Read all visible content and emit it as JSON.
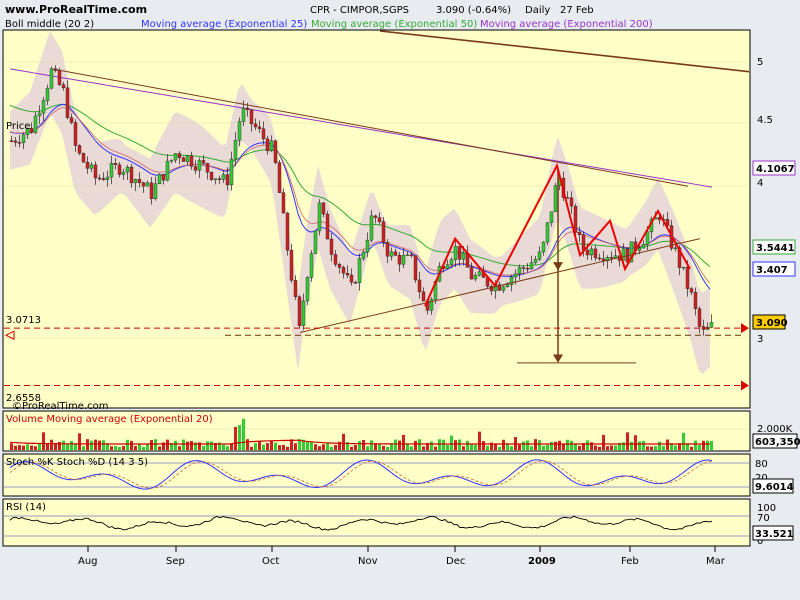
{
  "header": {
    "website": "www.ProRealTime.com",
    "instrument": "CPR - CIMPOR,SGPS",
    "quote": "3.090 (-0.64%)",
    "period": "Daily",
    "date": "27 Feb"
  },
  "colors": {
    "background": "#ffffc8",
    "boll_band": "#e8d6d6",
    "ma25": "#3333ff",
    "ma50": "#33aa33",
    "ma200": "#9933cc",
    "trend": "#7a3a1a",
    "zigzag": "#ee0000",
    "bull": "#33cc33",
    "bear": "#cc2222",
    "level": "#cc0000"
  },
  "chart_data": [
    {
      "panel": "price",
      "type": "candlestick",
      "legend": [
        {
          "name": "Boll middle (20 2)",
          "color": "#cc3333"
        },
        {
          "name": "Moving average (Exponential 25)",
          "color": "#3333ff"
        },
        {
          "name": "Moving average (Exponential 50)",
          "color": "#33aa33"
        },
        {
          "name": "Moving average (Exponential 200)",
          "color": "#9933cc"
        }
      ],
      "price_label": "Price",
      "y_ticks": [
        "5",
        "4.5",
        "4",
        "3"
      ],
      "ylim": [
        2.5,
        5.3
      ],
      "last_value": "3.090",
      "value_tags": [
        {
          "label": "4.1067",
          "value": 4.1067,
          "color": "#9933cc"
        },
        {
          "label": "3.5441",
          "value": 3.5441,
          "color": "#33aa33"
        },
        {
          "label": "3.407",
          "value": 3.407,
          "color": "#3333ff"
        }
      ],
      "levels": [
        {
          "label": "3.0713",
          "value": 3.0713
        },
        {
          "label": "2.6558",
          "value": 2.6558
        }
      ],
      "x_labels": [
        "Aug",
        "Sep",
        "Oct",
        "Nov",
        "Dec",
        "2009",
        "Feb",
        "Mar"
      ],
      "watermark": "©ProRealTime.com"
    },
    {
      "panel": "volume",
      "type": "bar",
      "title": "Volume Moving average (Exponential 20)",
      "y_ticks": [
        "2.000K"
      ],
      "last_value": "603,350"
    },
    {
      "panel": "stochastic",
      "type": "line",
      "title": "Stoch %K Stoch %D (14 3 5)",
      "y_ticks": [
        "80",
        "20"
      ],
      "last_value": "9.6014"
    },
    {
      "panel": "rsi",
      "type": "line",
      "title": "RSI (14)",
      "y_ticks": [
        "100",
        "70",
        "0"
      ],
      "last_value": "33.521"
    }
  ]
}
